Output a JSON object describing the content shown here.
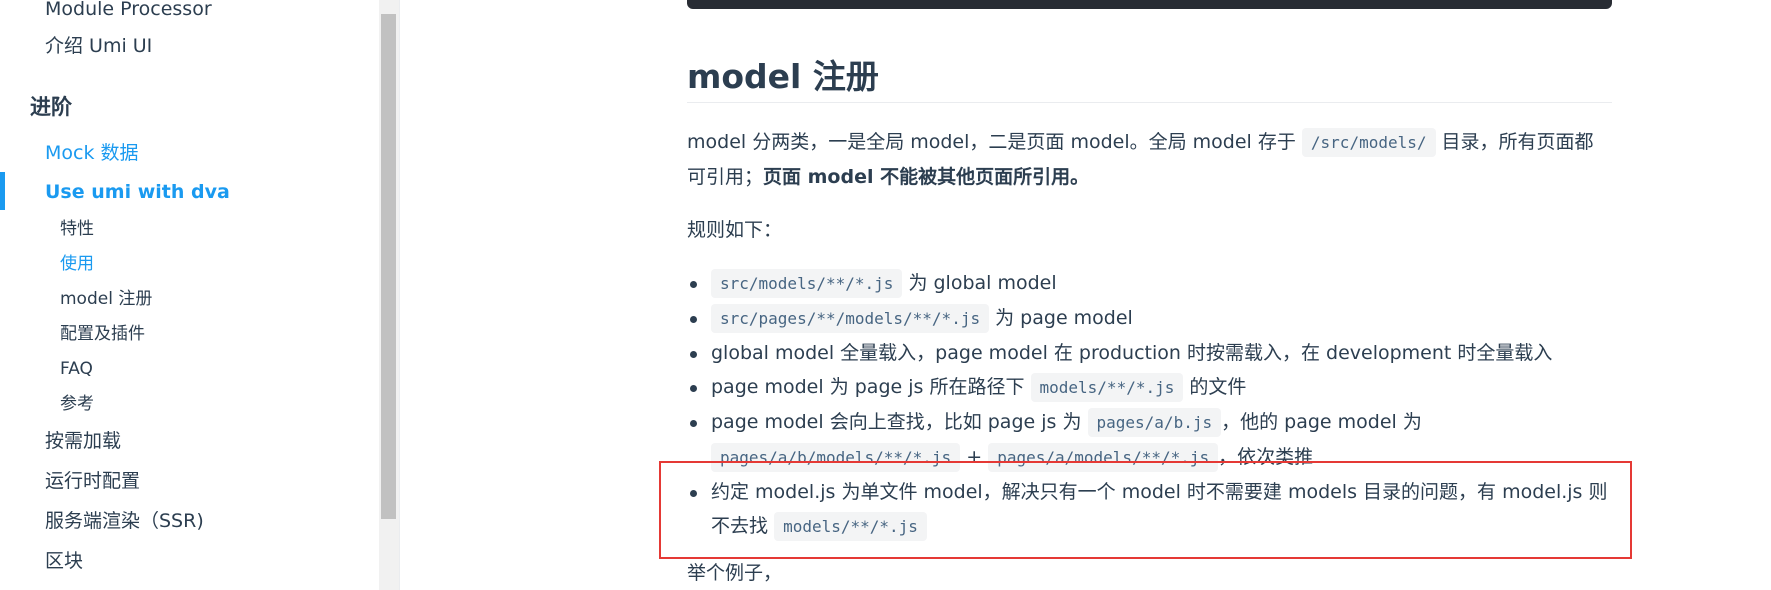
{
  "sidebar": {
    "items_top": [
      "Module Processor",
      "介绍 Umi UI"
    ],
    "group_title": "进阶",
    "mock": "Mock 数据",
    "dva": "Use umi with dva",
    "sub_items": [
      "特性",
      "使用",
      "model 注册",
      "配置及插件",
      "FAQ",
      "参考"
    ],
    "items_bottom": [
      "按需加载",
      "运行时配置",
      "服务端渲染（SSR)",
      "区块"
    ]
  },
  "content": {
    "heading": "model 注册",
    "p1": {
      "t1": "model 分两类，一是全局 model，二是页面 model。全局 model 存于",
      "code": "/src/models/",
      "t2": "目录，所有页面都可引用；",
      "bold": "页面 model 不能被其他页面所引用。"
    },
    "rules_title": "规则如下：",
    "list": {
      "i1_code": "src/models/**/*.js",
      "i1_text": "为 global model",
      "i2_code": "src/pages/**/models/**/*.js",
      "i2_text": "为 page model",
      "i3_text": "global model 全量载入，page model 在 production 时按需载入，在 development 时全量载入",
      "i4_text": "page model 为 page js 所在路径下",
      "i4_code": "models/**/*.js",
      "i4_text2": "的文件",
      "i5_text": "page model 会向上查找，比如 page js 为",
      "i5_code1": "pages/a/b.js",
      "i5_text2": "，他的 page model 为",
      "i5_code2": "pages/a/b/models/**/*.js",
      "i5_plus": "+",
      "i5_code3": "pages/a/models/**/*.js",
      "i5_text3": "，依次类推",
      "i6_text": "约定 model.js 为单文件 model，解决只有一个 model 时不需要建 models 目录的问题，有 model.js 则不去找",
      "i6_code": "models/**/*.js"
    },
    "example": "举个例子，"
  },
  "colors": {
    "accent": "#1a9af0",
    "highlight_box": "#e53935",
    "text": "#2c3e50"
  }
}
